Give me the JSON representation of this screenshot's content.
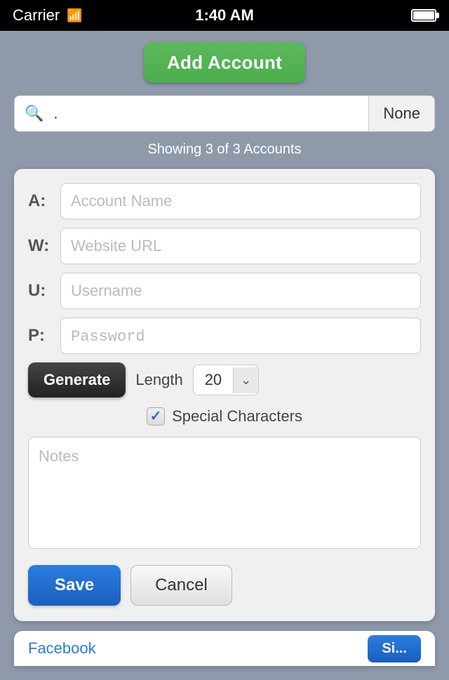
{
  "statusBar": {
    "carrier": "Carrier",
    "time": "1:40 AM"
  },
  "header": {
    "addAccountLabel": "Add Account"
  },
  "searchBar": {
    "value": ".",
    "noneLabel": "None"
  },
  "showingText": "Showing 3 of 3 Accounts",
  "form": {
    "accountNameLabel": "A:",
    "accountNamePlaceholder": "Account Name",
    "websiteLabel": "W:",
    "websitePlaceholder": "Website URL",
    "usernameLabel": "U:",
    "usernamePlaceholder": "Username",
    "passwordLabel": "P:",
    "passwordPlaceholder": "Password",
    "generateLabel": "Generate",
    "lengthLabel": "Length",
    "lengthValue": "20",
    "specialCharsLabel": "Special Characters",
    "notesPlaceholder": "Notes",
    "saveLabel": "Save",
    "cancelLabel": "Cancel"
  },
  "bottomPeek": {
    "text": "Facebook",
    "buttonLabel": "Si..."
  }
}
